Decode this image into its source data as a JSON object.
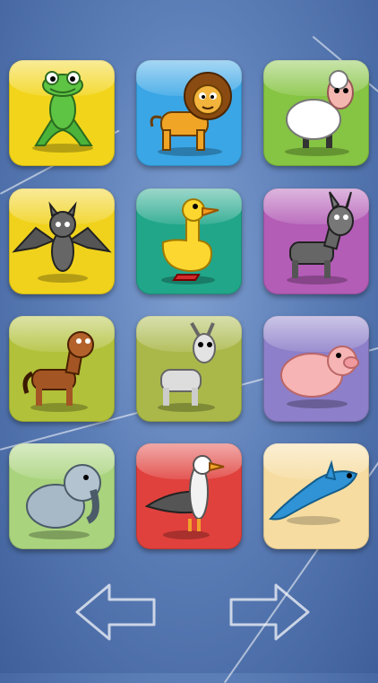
{
  "tiles": [
    {
      "animal": "frog-icon",
      "color": "#f2d51a"
    },
    {
      "animal": "lion-icon",
      "color": "#3aa6e6"
    },
    {
      "animal": "sheep-icon",
      "color": "#86c443"
    },
    {
      "animal": "bat-icon",
      "color": "#f0d21c"
    },
    {
      "animal": "duck-icon",
      "color": "#21a68a"
    },
    {
      "animal": "donkey-icon",
      "color": "#b35db6"
    },
    {
      "animal": "horse-icon",
      "color": "#b1c13a"
    },
    {
      "animal": "goat-icon",
      "color": "#aab84a"
    },
    {
      "animal": "pig-icon",
      "color": "#8d7fc9"
    },
    {
      "animal": "elephant-icon",
      "color": "#a9d37d"
    },
    {
      "animal": "seagull-icon",
      "color": "#e0413d"
    },
    {
      "animal": "dolphin-icon",
      "color": "#f6dca0"
    }
  ],
  "nav": {
    "prev": "arrow-left-icon",
    "next": "arrow-right-icon"
  }
}
